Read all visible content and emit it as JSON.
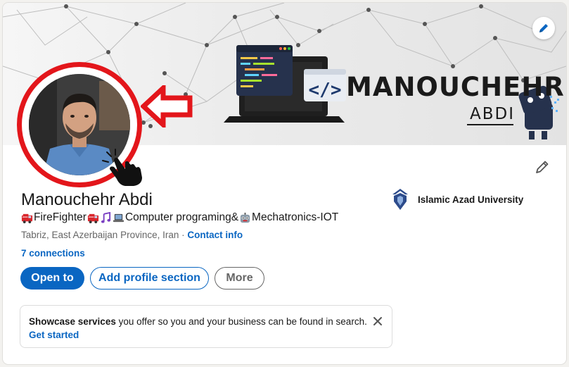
{
  "profile": {
    "name": "Manouchehr Abdi",
    "headline_parts": [
      "FireFighter",
      "Computer programing&",
      "Mechatronics-IOT"
    ],
    "location": "Tabriz, East Azerbaijan Province, Iran",
    "location_separator": " · ",
    "contact_info": "Contact info",
    "connections": "7 connections"
  },
  "education": {
    "name": "Islamic Azad University",
    "logo_icon": "university-logo-icon"
  },
  "banner": {
    "brand_name": "MANOUCHEHR",
    "brand_sub": "ABDI",
    "edit_icon": "pencil-icon",
    "accent": "#1a1a1a"
  },
  "buttons": {
    "open_to": "Open to",
    "add_section": "Add profile section",
    "more": "More"
  },
  "showcase": {
    "bold": "Showcase services",
    "text": " you offer so you and your business can be found in search.",
    "link": "Get started",
    "close_icon": "close-icon"
  },
  "colors": {
    "primary": "#0a66c2",
    "highlight": "#e3161b",
    "muted": "#666666"
  }
}
